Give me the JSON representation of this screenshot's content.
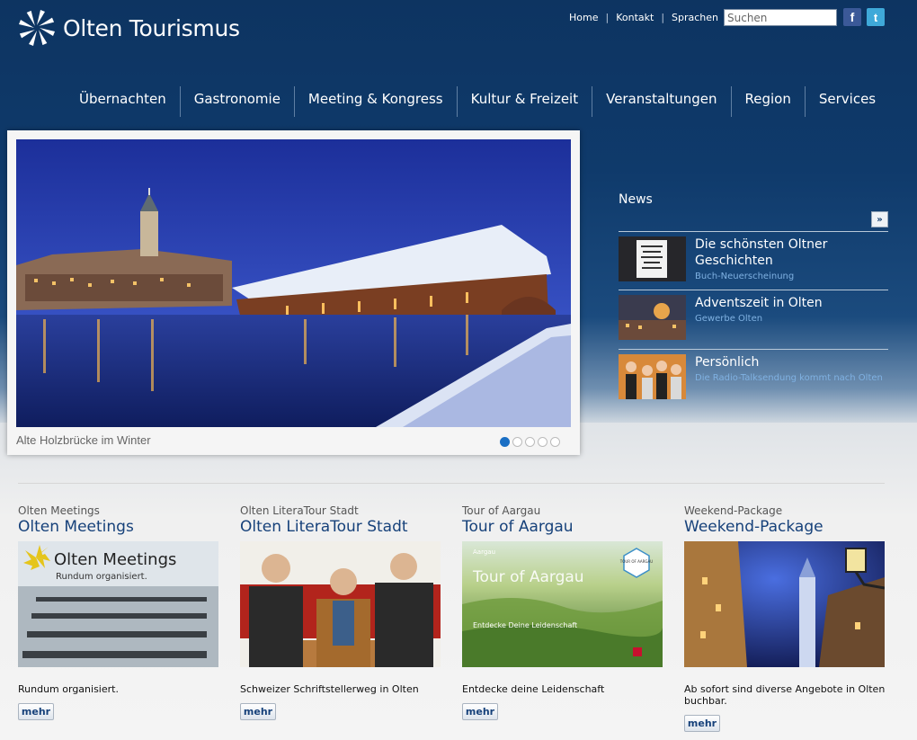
{
  "brand": {
    "name": "Olten Tourismus"
  },
  "toplinks": [
    "Home",
    "Kontakt",
    "Sprachen"
  ],
  "search": {
    "placeholder": "Suchen"
  },
  "social": {
    "facebook": "f",
    "twitter": "t"
  },
  "nav": [
    "Übernachten",
    "Gastronomie",
    "Meeting & Kongress",
    "Kultur & Freizeit",
    "Veranstaltungen",
    "Region",
    "Services"
  ],
  "slider": {
    "caption": "Alte Holzbrücke im Winter",
    "slide_count": 5,
    "active_index": 0
  },
  "news": {
    "title": "News",
    "more": "»",
    "items": [
      {
        "headline": "Die schönsten Oltner Geschichten",
        "sub": "Buch-Neuerscheinung"
      },
      {
        "headline": "Adventszeit in Olten",
        "sub": "Gewerbe Olten"
      },
      {
        "headline": "Persönlich",
        "sub": "Die Radio-Talksendung kommt nach Olten"
      }
    ]
  },
  "teasers": [
    {
      "small_title": "Olten Meetings",
      "title": "Olten Meetings",
      "image_title": "Olten Meetings",
      "image_sub": "Rundum organisiert.",
      "desc": "Rundum organisiert.",
      "button": "mehr"
    },
    {
      "small_title": "Olten LiteraTour Stadt",
      "title": "Olten LiteraTour Stadt",
      "desc": "Schweizer Schriftstellerweg in Olten",
      "button": "mehr"
    },
    {
      "small_title": "Tour of Aargau",
      "title": "Tour of Aargau",
      "image_title": "Tour of Aargau",
      "image_sub": "Entdecke Deine Leidenschaft",
      "image_badge": "TOUR OF AARGAU",
      "image_brand": "Aargau",
      "desc": "Entdecke deine Leidenschaft",
      "button": "mehr"
    },
    {
      "small_title": "Weekend-Package",
      "title": "Weekend-Package",
      "desc": "Ab sofort sind diverse Angebote in Olten buchbar.",
      "button": "mehr"
    }
  ]
}
